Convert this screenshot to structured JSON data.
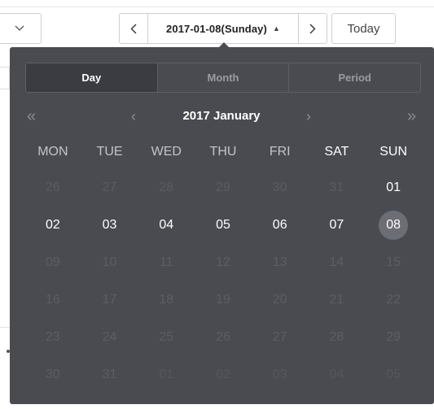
{
  "toolbar": {
    "current_date": "2017-01-08(Sunday)",
    "caret": "▲",
    "today_label": "Today"
  },
  "picker": {
    "modes": [
      "Day",
      "Month",
      "Period"
    ],
    "active_mode": "Day",
    "month_title": "2017 January",
    "nav": {
      "prev_year": "«",
      "prev_month": "‹",
      "next_month": "›",
      "next_year": "»"
    },
    "weekdays": [
      "MON",
      "TUE",
      "WED",
      "THU",
      "FRI",
      "SAT",
      "SUN"
    ],
    "weeks": [
      [
        {
          "d": "26",
          "s": "other"
        },
        {
          "d": "27",
          "s": "other"
        },
        {
          "d": "28",
          "s": "other"
        },
        {
          "d": "29",
          "s": "other"
        },
        {
          "d": "30",
          "s": "other"
        },
        {
          "d": "31",
          "s": "other"
        },
        {
          "d": "01",
          "s": "normal"
        }
      ],
      [
        {
          "d": "02",
          "s": "normal"
        },
        {
          "d": "03",
          "s": "normal"
        },
        {
          "d": "04",
          "s": "normal"
        },
        {
          "d": "05",
          "s": "normal"
        },
        {
          "d": "06",
          "s": "normal"
        },
        {
          "d": "07",
          "s": "normal"
        },
        {
          "d": "08",
          "s": "selected"
        }
      ],
      [
        {
          "d": "09",
          "s": "disabled"
        },
        {
          "d": "10",
          "s": "disabled"
        },
        {
          "d": "11",
          "s": "disabled"
        },
        {
          "d": "12",
          "s": "disabled"
        },
        {
          "d": "13",
          "s": "disabled"
        },
        {
          "d": "14",
          "s": "disabled"
        },
        {
          "d": "15",
          "s": "disabled"
        }
      ],
      [
        {
          "d": "16",
          "s": "disabled"
        },
        {
          "d": "17",
          "s": "disabled"
        },
        {
          "d": "18",
          "s": "disabled"
        },
        {
          "d": "19",
          "s": "disabled"
        },
        {
          "d": "20",
          "s": "disabled"
        },
        {
          "d": "21",
          "s": "disabled"
        },
        {
          "d": "22",
          "s": "disabled"
        }
      ],
      [
        {
          "d": "23",
          "s": "disabled"
        },
        {
          "d": "24",
          "s": "disabled"
        },
        {
          "d": "25",
          "s": "disabled"
        },
        {
          "d": "26",
          "s": "disabled"
        },
        {
          "d": "27",
          "s": "disabled"
        },
        {
          "d": "28",
          "s": "disabled"
        },
        {
          "d": "29",
          "s": "disabled"
        }
      ],
      [
        {
          "d": "30",
          "s": "disabled"
        },
        {
          "d": "31",
          "s": "disabled"
        },
        {
          "d": "01",
          "s": "future"
        },
        {
          "d": "02",
          "s": "future"
        },
        {
          "d": "03",
          "s": "future"
        },
        {
          "d": "04",
          "s": "future"
        },
        {
          "d": "05",
          "s": "future"
        }
      ]
    ]
  },
  "icons": {
    "dropdown": "chevron-down-icon",
    "prev": "chevron-left-icon",
    "next": "chevron-right-icon"
  },
  "colors": {
    "popup_bg": "#4a4b51",
    "active_tab_bg": "#3b3c41",
    "selected_day_bg": "#6c6e75"
  }
}
